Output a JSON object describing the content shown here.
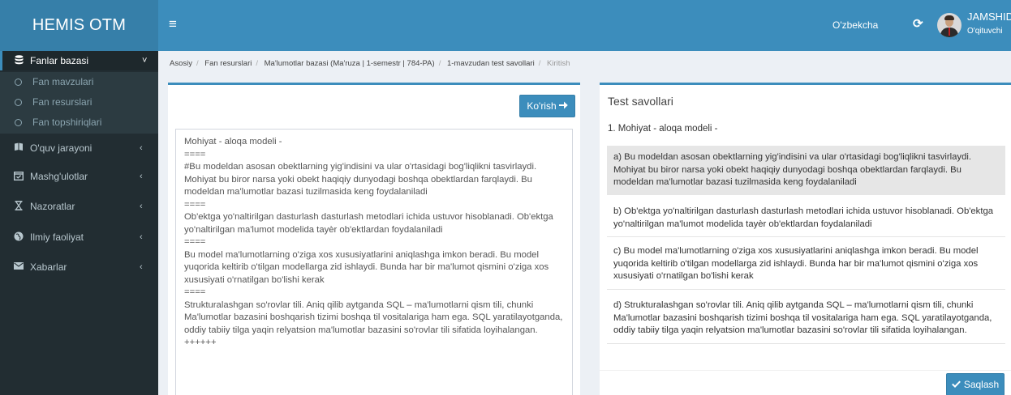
{
  "app": {
    "logo": "HEMIS OTM"
  },
  "header": {
    "menu_icon": "hamburger-icon",
    "language": "O'zbekcha",
    "refresh_icon": "refresh-icon",
    "user_name": "JAMSHID ELOV",
    "user_role": "O'qituvchi"
  },
  "sidebar": {
    "items": [
      {
        "label": "Fanlar bazasi",
        "icon": "database-icon",
        "arrow": "˅"
      },
      {
        "label": "O'quv jarayoni",
        "icon": "book-icon",
        "arrow": "‹"
      },
      {
        "label": "Mashg'ulotlar",
        "icon": "calendar-check-icon",
        "arrow": "‹"
      },
      {
        "label": "Nazoratlar",
        "icon": "hourglass-icon",
        "arrow": "‹"
      },
      {
        "label": "Ilmiy faoliyat",
        "icon": "globe-icon",
        "arrow": "‹"
      },
      {
        "label": "Xabarlar",
        "icon": "envelope-icon",
        "arrow": "‹"
      }
    ],
    "subitems": [
      {
        "label": "Fan mavzulari"
      },
      {
        "label": "Fan resurslari"
      },
      {
        "label": "Fan topshiriqlari"
      }
    ]
  },
  "breadcrumb": {
    "items": [
      "Asosiy",
      "Fan resurslari",
      "Ma'lumotlar bazasi (Ma'ruza | 1-semestr | 784-PA)",
      "1-mavzudan test savollari"
    ],
    "current": "Kiritish"
  },
  "editor": {
    "button_label": "Ko'rish",
    "content": "Mohiyat - aloqa modeli -\n====\n#Bu modeldan asosan obektlarning yig'indisini va ular o'rtasidagi bog'liqlikni tasvirlaydi. Mohiyat bu biror narsa yoki obekt haqiqiy dunyodagi boshqa obektlardan farqlaydi. Bu modeldan ma'lumotlar bazasi tuzilmasida keng foydalaniladi\n====\nOb'ektga yo'naltirilgan dasturlash dasturlash metodlari ichida ustuvor hisoblanadi. Ob'ektga yo'naltirilgan ma'lumot modelida tayèr ob'ektlardan foydalaniladi\n====\nBu model ma'lumotlarning o'ziga xos xususiyatlarini aniqlashga imkon beradi. Bu model yuqorida keltirib o'tilgan modellarga zid ishlaydi. Bunda har bir ma'lumot qismini o'ziga xos xususiyati o'rnatilgan bo'lishi kerak\n====\nStrukturalashgan so'rovlar tili. Aniq qilib aytganda SQL – ma'lumotlarni qism tili, chunki Ma'lumotlar bazasini boshqarish tizimi boshqa til vositalariga ham ega. SQL yaratilayotganda, oddiy tabiiy tilga yaqin relyatsion ma'lumotlar bazasini so'rovlar tili sifatida loyihalangan.\n++++++"
  },
  "test": {
    "title": "Test savollari",
    "question": "1. Mohiyat - aloqa modeli -",
    "answers": [
      {
        "text": "a) Bu modeldan asosan obektlarning yig'indisini va ular o'rtasidagi bog'liqlikni tasvirlaydi. Mohiyat bu biror narsa yoki obekt haqiqiy dunyodagi boshqa obektlardan farqlaydi. Bu modeldan ma'lumotlar bazasi tuzilmasida keng foydalaniladi"
      },
      {
        "text": "b) Ob'ektga yo'naltirilgan dasturlash dasturlash metodlari ichida ustuvor hisoblanadi. Ob'ektga yo'naltirilgan ma'lumot modelida tayèr ob'ektlardan foydalaniladi"
      },
      {
        "text": "c) Bu model ma'lumotlarning o'ziga xos xususiyatlarini aniqlashga imkon beradi. Bu model yuqorida keltirib o'tilgan modellarga zid ishlaydi. Bunda har bir ma'lumot qismini o'ziga xos xususiyati o'rnatilgan bo'lishi kerak"
      },
      {
        "text": "d) Strukturalashgan so'rovlar tili. Aniq qilib aytganda SQL – ma'lumotlarni qism tili, chunki Ma'lumotlar bazasini boshqarish tizimi boshqa til vositalariga ham ega. SQL yaratilayotganda, oddiy tabiiy tilga yaqin relyatsion ma'lumotlar bazasini so'rovlar tili sifatida loyihalangan."
      }
    ],
    "save_label": "Saqlash"
  },
  "colors": {
    "primary": "#3c8dbc",
    "logo_bg": "#367fa9",
    "sidebar_bg": "#222d32",
    "selected_answer_bg": "#e6e6e6"
  }
}
